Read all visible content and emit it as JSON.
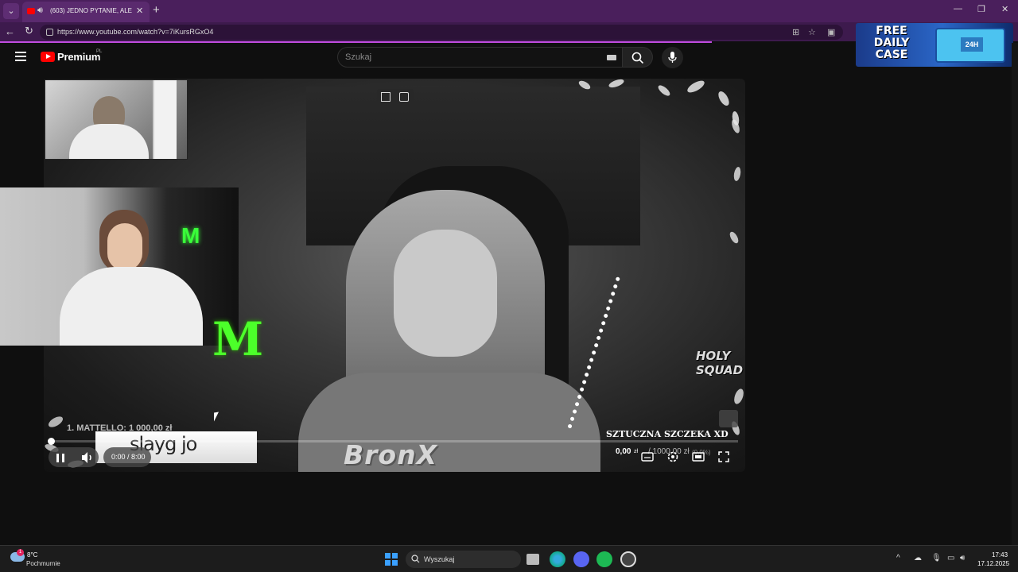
{
  "browser": {
    "tab_title": "(603) JEDNO PYTANIE, ALE 10",
    "url": "https://www.youtube.com/watch?v=7iKursRGxO4"
  },
  "ad": {
    "headline": "FREE DAILY CASE",
    "badge": "24H"
  },
  "youtube": {
    "brand": "Premium",
    "country": "PL",
    "search_placeholder": "Szukaj"
  },
  "video": {
    "overlay_left": "1. MATTELLO: 1 000,00 zł",
    "chat_message": "slayg jo",
    "stream_name": "BronX",
    "scene_logo": "HOLY SQUAD",
    "goal_title": "SZTUCZNA SZCZEKA XD",
    "goal_progress": "0,00",
    "goal_currency": "zł",
    "goal_target": "/ 1000,00 zł",
    "goal_percent": "(0.0%)",
    "time": "0:00 / 8:00",
    "progress": 0.0
  },
  "taskbar": {
    "temperature": "8°C",
    "weather": "Pochmurnie",
    "weather_badge": "1",
    "search_label": "Wyszukaj",
    "clock_time": "17:43",
    "clock_date": "17.12.2025"
  },
  "colors": {
    "accent": "#ff0000",
    "tab_purple": "#4a1f5c",
    "monster_green": "#4cff2a"
  }
}
